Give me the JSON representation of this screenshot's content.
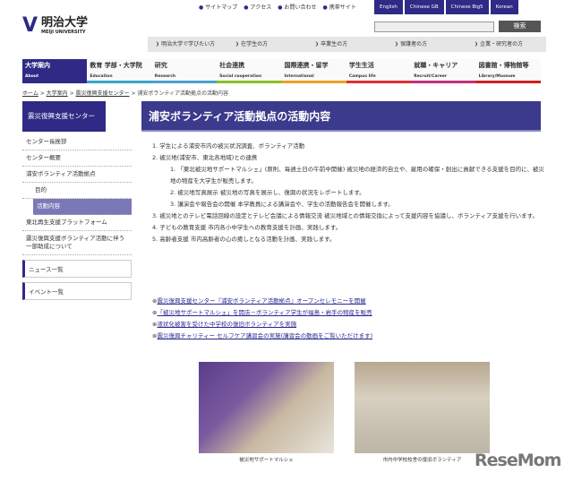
{
  "top_links": [
    "サイトマップ",
    "アクセス",
    "お問い合わせ",
    "携帯サイト"
  ],
  "languages": [
    "English",
    "Chinese GB",
    "Chinese Big5",
    "Korean"
  ],
  "logo": {
    "jp": "明治大学",
    "en": "MEIJI UNIVERSITY"
  },
  "search_button": "検索",
  "audience_nav": [
    "明治大学で学びたい方",
    "在学生の方",
    "卒業生の方",
    "保護者の方",
    "企業・研究者の方"
  ],
  "main_nav": [
    {
      "jp": "大学案内",
      "en": "About",
      "color": "#2e2a85"
    },
    {
      "jp": "教育 学部・大学院",
      "en": "Education",
      "color": "#3aa6c8"
    },
    {
      "jp": "研究",
      "en": "Research",
      "color": "#4aa0d0"
    },
    {
      "jp": "社会連携",
      "en": "Social cooperation",
      "color": "#8cbf26"
    },
    {
      "jp": "国際連携・留学",
      "en": "International",
      "color": "#f0a020"
    },
    {
      "jp": "学生生活",
      "en": "Campus life",
      "color": "#e03030"
    },
    {
      "jp": "就職・キャリア",
      "en": "Recruit/Career",
      "color": "#c0307a"
    },
    {
      "jp": "図書館・博物館等",
      "en": "Library/Museum",
      "color": "#d02020"
    }
  ],
  "breadcrumb": [
    "ホーム",
    "大学案内",
    "震災復興支援センター",
    "浦安ボランティア活動拠点の活動内容"
  ],
  "sidebar": {
    "title": "震災復興支援センター",
    "items": [
      "センター長挨拶",
      "センター概要",
      "浦安ボランティア活動拠点",
      "目的",
      "活動内容",
      "東北再生支援プラットフォーム",
      "震災復興支援ボランティア活動に伴う一部助成について"
    ],
    "boxes": [
      "ニュース一覧",
      "イベント一覧"
    ]
  },
  "page_title": "浦安ボランティア活動拠点の活動内容",
  "content": [
    "1. 学生による浦安市内の被災状況調査、ボランティア活動",
    "2. 被災地(浦安市、東北各地域)との連携",
    "1. 「東北被災地サポートマルシェ」(原則、毎週土日の午前中開催) 被災地の経済的自立や、雇用の確保・創出に貢献できる支援を目的に、被災地の物産を大学生が販売します。",
    "2. 被災地写真展示 被災地の写真を展示し、復興の状況をレポートします。",
    "3. 講演会や報告会の開催 本学教員による講演会や、学生の活動報告会を開催します。",
    "3. 被災地とのテレビ電話回線の設定とテレビ会議による情報交流 被災地域との情報交換によって支援内容を協議し、ボランティア支援を行います。",
    "4. 子どもの教育支援 市内各小中学生への教育支援を計画、実践します。",
    "5. 高齢者支援 市内高齢者の心の癒しとなる活動を計画、実践します。"
  ],
  "links": [
    "震災復興支援センター『浦安ボランティア活動拠点』オープンセレモニーを開催",
    "「被災地サポートマルシェ」を開店－ボランティア学生が福島・岩手の物産を販売",
    "液状化被害を受けた中学校の復旧ボランティアを実施",
    "震災復興チャリティー セルフケア講習会の実施(講習会の動画をご覧いただけます)"
  ],
  "photos": [
    {
      "caption": "被災地サポートマルシェ"
    },
    {
      "caption": "市内中学校校舎の復旧ボランティア"
    }
  ],
  "watermark": "ReseMom"
}
